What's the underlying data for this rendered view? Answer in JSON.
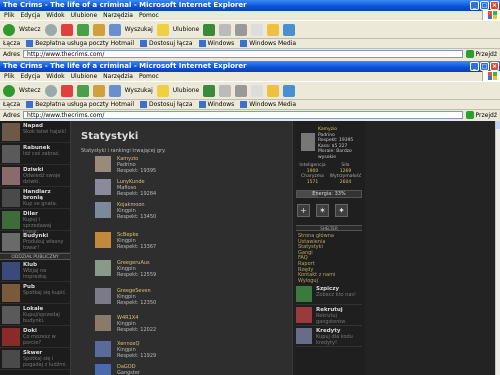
{
  "windows": [
    {
      "title": "The Crims - The life of a criminal - Microsoft Internet Explorer",
      "menu": [
        "Plik",
        "Edycja",
        "Widok",
        "Ulubione",
        "Narzędzia",
        "Pomoc"
      ],
      "toolbar": {
        "back": "Wstecz",
        "search": "Wyszukaj",
        "favorites": "Ulubione"
      },
      "links_label": "Łącza",
      "links": [
        "Bezpłatna usługa poczty Hotmail",
        "Dostosuj łącza",
        "Windows",
        "Windows Media"
      ],
      "address_label": "Adres",
      "address": "http://www.thecrims.com/",
      "go": "Przejdź"
    },
    {
      "title": "The Crims - The life of a criminal - Microsoft Internet Explorer",
      "menu": [
        "Plik",
        "Edycja",
        "Widok",
        "Ulubione",
        "Narzędzia",
        "Pomoc"
      ],
      "toolbar": {
        "back": "Wstecz",
        "search": "Wyszukaj",
        "favorites": "Ulubione"
      },
      "links_label": "Łącza",
      "links": [
        "Bezpłatna usługa poczty Hotmail",
        "Dostosuj łącza",
        "Windows",
        "Windows Media"
      ],
      "address_label": "Adres",
      "address": "http://www.thecrims.com/",
      "go": "Przejdź"
    }
  ],
  "left": {
    "items_top": [
      {
        "title": "Napad",
        "desc": "Skok łatwi hajsik!"
      },
      {
        "title": "Rabunek",
        "desc": "Idź coś zabrać."
      },
      {
        "title": "Dziwki",
        "desc": "Odwiedź swoje dziwki."
      },
      {
        "title": "Handlarz bronią",
        "desc": "Kup se gnata."
      },
      {
        "title": "Diler",
        "desc": "Kupuj i sprzedawaj towar."
      },
      {
        "title": "Budynki",
        "desc": "Produkuj własny towar!"
      }
    ],
    "section": "ODDZIAŁ PUBLICZNY",
    "items_bottom": [
      {
        "title": "Klub",
        "desc": "Wbijaj na imprezkę."
      },
      {
        "title": "Pub",
        "desc": "Spotkaj się kupić."
      },
      {
        "title": "Lokale",
        "desc": "Kupuj/sprzedaj budynki."
      },
      {
        "title": "Doki",
        "desc": "Co mozesz w porcie?"
      },
      {
        "title": "Skwer",
        "desc": "Spotkaj się i pogadaj z ludźmi."
      }
    ]
  },
  "main": {
    "title": "Statystyki",
    "subtitle": "Statystyki i rankingi trwającej gry.",
    "ranks": [
      {
        "name": "Kamyzio",
        "role": "Padrino",
        "respect": "Respekt: 19395"
      },
      {
        "name": "LunyKunde",
        "role": "Mafioso",
        "respect": "Respekt: 19284"
      },
      {
        "name": "Kojakmoon",
        "role": "Kingpin",
        "respect": "Respekt: 13450"
      },
      {
        "name": "ScBepke",
        "role": "Kingpin",
        "respect": "Respekt: 13367"
      },
      {
        "name": "GreegeruAus",
        "role": "Kingpin",
        "respect": "Respekt: 12559"
      },
      {
        "name": "GreegeSeven",
        "role": "Kingpin",
        "respect": "Respekt: 12350"
      },
      {
        "name": "W4R1X4",
        "role": "Kingpin",
        "respect": "Respekt: 12022"
      },
      {
        "name": "XennoxQ",
        "role": "Kingpin",
        "respect": "Respekt: 11929"
      },
      {
        "name": "DaGOD",
        "role": "Gangster",
        "respect": ""
      }
    ]
  },
  "right": {
    "profile": {
      "name": "Kamyzio",
      "rank": "Padrino",
      "respect": "Respekt: 19395",
      "cash": "Kasa: $5 227",
      "morale": "Morale: Bardzo wysokie"
    },
    "stats": [
      {
        "label": "Inteligencja",
        "value": "1900"
      },
      {
        "label": "Siła",
        "value": "1269"
      },
      {
        "label": "Charyzma",
        "value": "1571"
      },
      {
        "label": "Wytrzymałość",
        "value": "2604"
      }
    ],
    "energy": {
      "label": "Energia: 33%",
      "value": 33
    },
    "section": "SHELTER",
    "links": [
      "Strona główna",
      "Ustawienia",
      "Statystyki",
      "Gangi",
      "FAQ",
      "Raport",
      "Rzędy",
      "Kontakt z nami",
      "Wyloguj"
    ],
    "items": [
      {
        "title": "Szpiczy",
        "desc": "Zobacz kto nas!"
      },
      {
        "title": "Rekrutuj",
        "desc": "Rekrutuj gangsterów"
      },
      {
        "title": "Kredyty",
        "desc": "Kupuj dla kodu kredyty!"
      }
    ]
  }
}
